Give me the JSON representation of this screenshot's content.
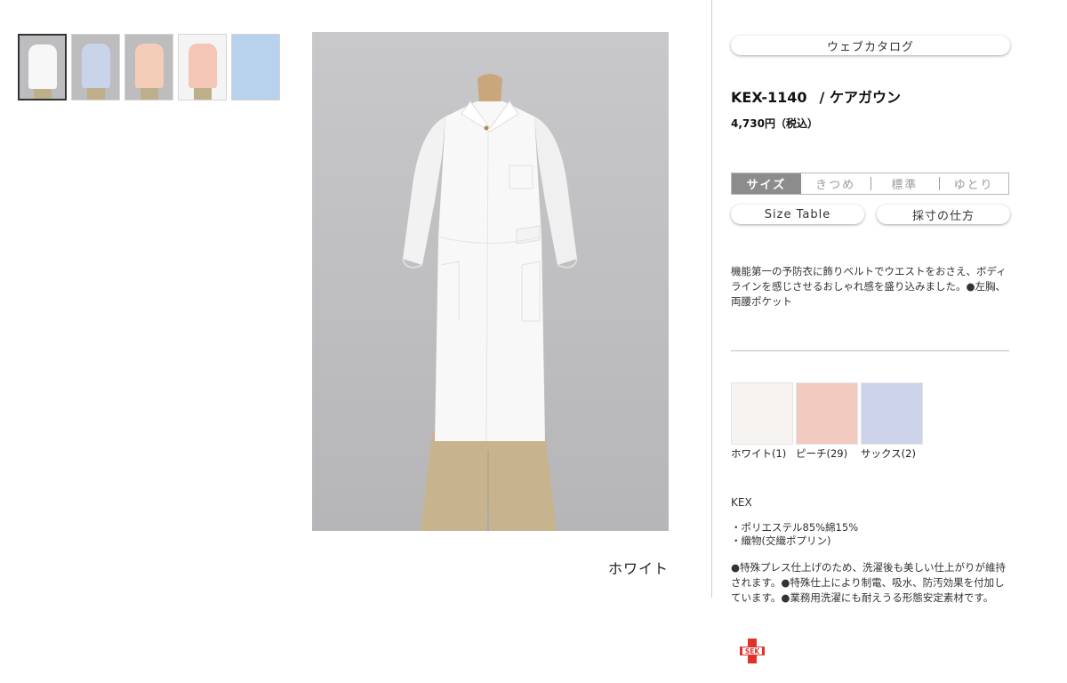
{
  "thumbnails": [
    {
      "name": "thumb-white",
      "bg": "#bdbdc0",
      "gown": "#f7f7f7",
      "selected": true
    },
    {
      "name": "thumb-sax",
      "bg": "#bdbdc0",
      "gown": "#c9d4ea",
      "selected": false
    },
    {
      "name": "thumb-peach",
      "bg": "#bdbdc0",
      "gown": "#f3cdb7",
      "selected": false
    },
    {
      "name": "thumb-peach-back",
      "bg": "#f4f4f4",
      "gown": "#f3c6b6",
      "selected": false
    },
    {
      "name": "thumb-fabric",
      "bg": "#b8d1ec",
      "gown": "",
      "selected": false
    }
  ],
  "main": {
    "caption": "ホワイト"
  },
  "panel": {
    "catalog_label": "ウェブカタログ",
    "product_code": "KEX-1140",
    "product_name": "/ ケアガウン",
    "price": "4,730円（税込）",
    "size": {
      "label": "サイズ",
      "options": [
        "きつめ",
        "標準",
        "ゆとり"
      ]
    },
    "size_table_label": "Size Table",
    "measure_label": "採寸の仕方",
    "description": "機能第一の予防衣に飾りベルトでウエストをおさえ、ボディラインを感じさせるおしゃれ感を盛り込みました。●左胸、両腰ポケット",
    "colors": [
      {
        "name": "ホワイト(1)",
        "swatch": "#f6f3f1"
      },
      {
        "name": "ピーチ(29)",
        "swatch": "#f3cac0"
      },
      {
        "name": "サックス(2)",
        "swatch": "#cdd4ea"
      }
    ],
    "brand": "KEX",
    "materials": [
      "・ポリエステル85%綿15%",
      "・織物(交織ポプリン)"
    ],
    "features": "●特殊プレス仕上げのため、洗濯後も美しい仕上がりが維持されます。●特殊仕上により制電、吸水、防汚効果を付加しています。●業務用洗濯にも耐えうる形態安定素材です。",
    "sek_text": "SEK"
  },
  "colors": {
    "accent_gray": "#8c8c8c",
    "sek_red": "#e0312b"
  }
}
